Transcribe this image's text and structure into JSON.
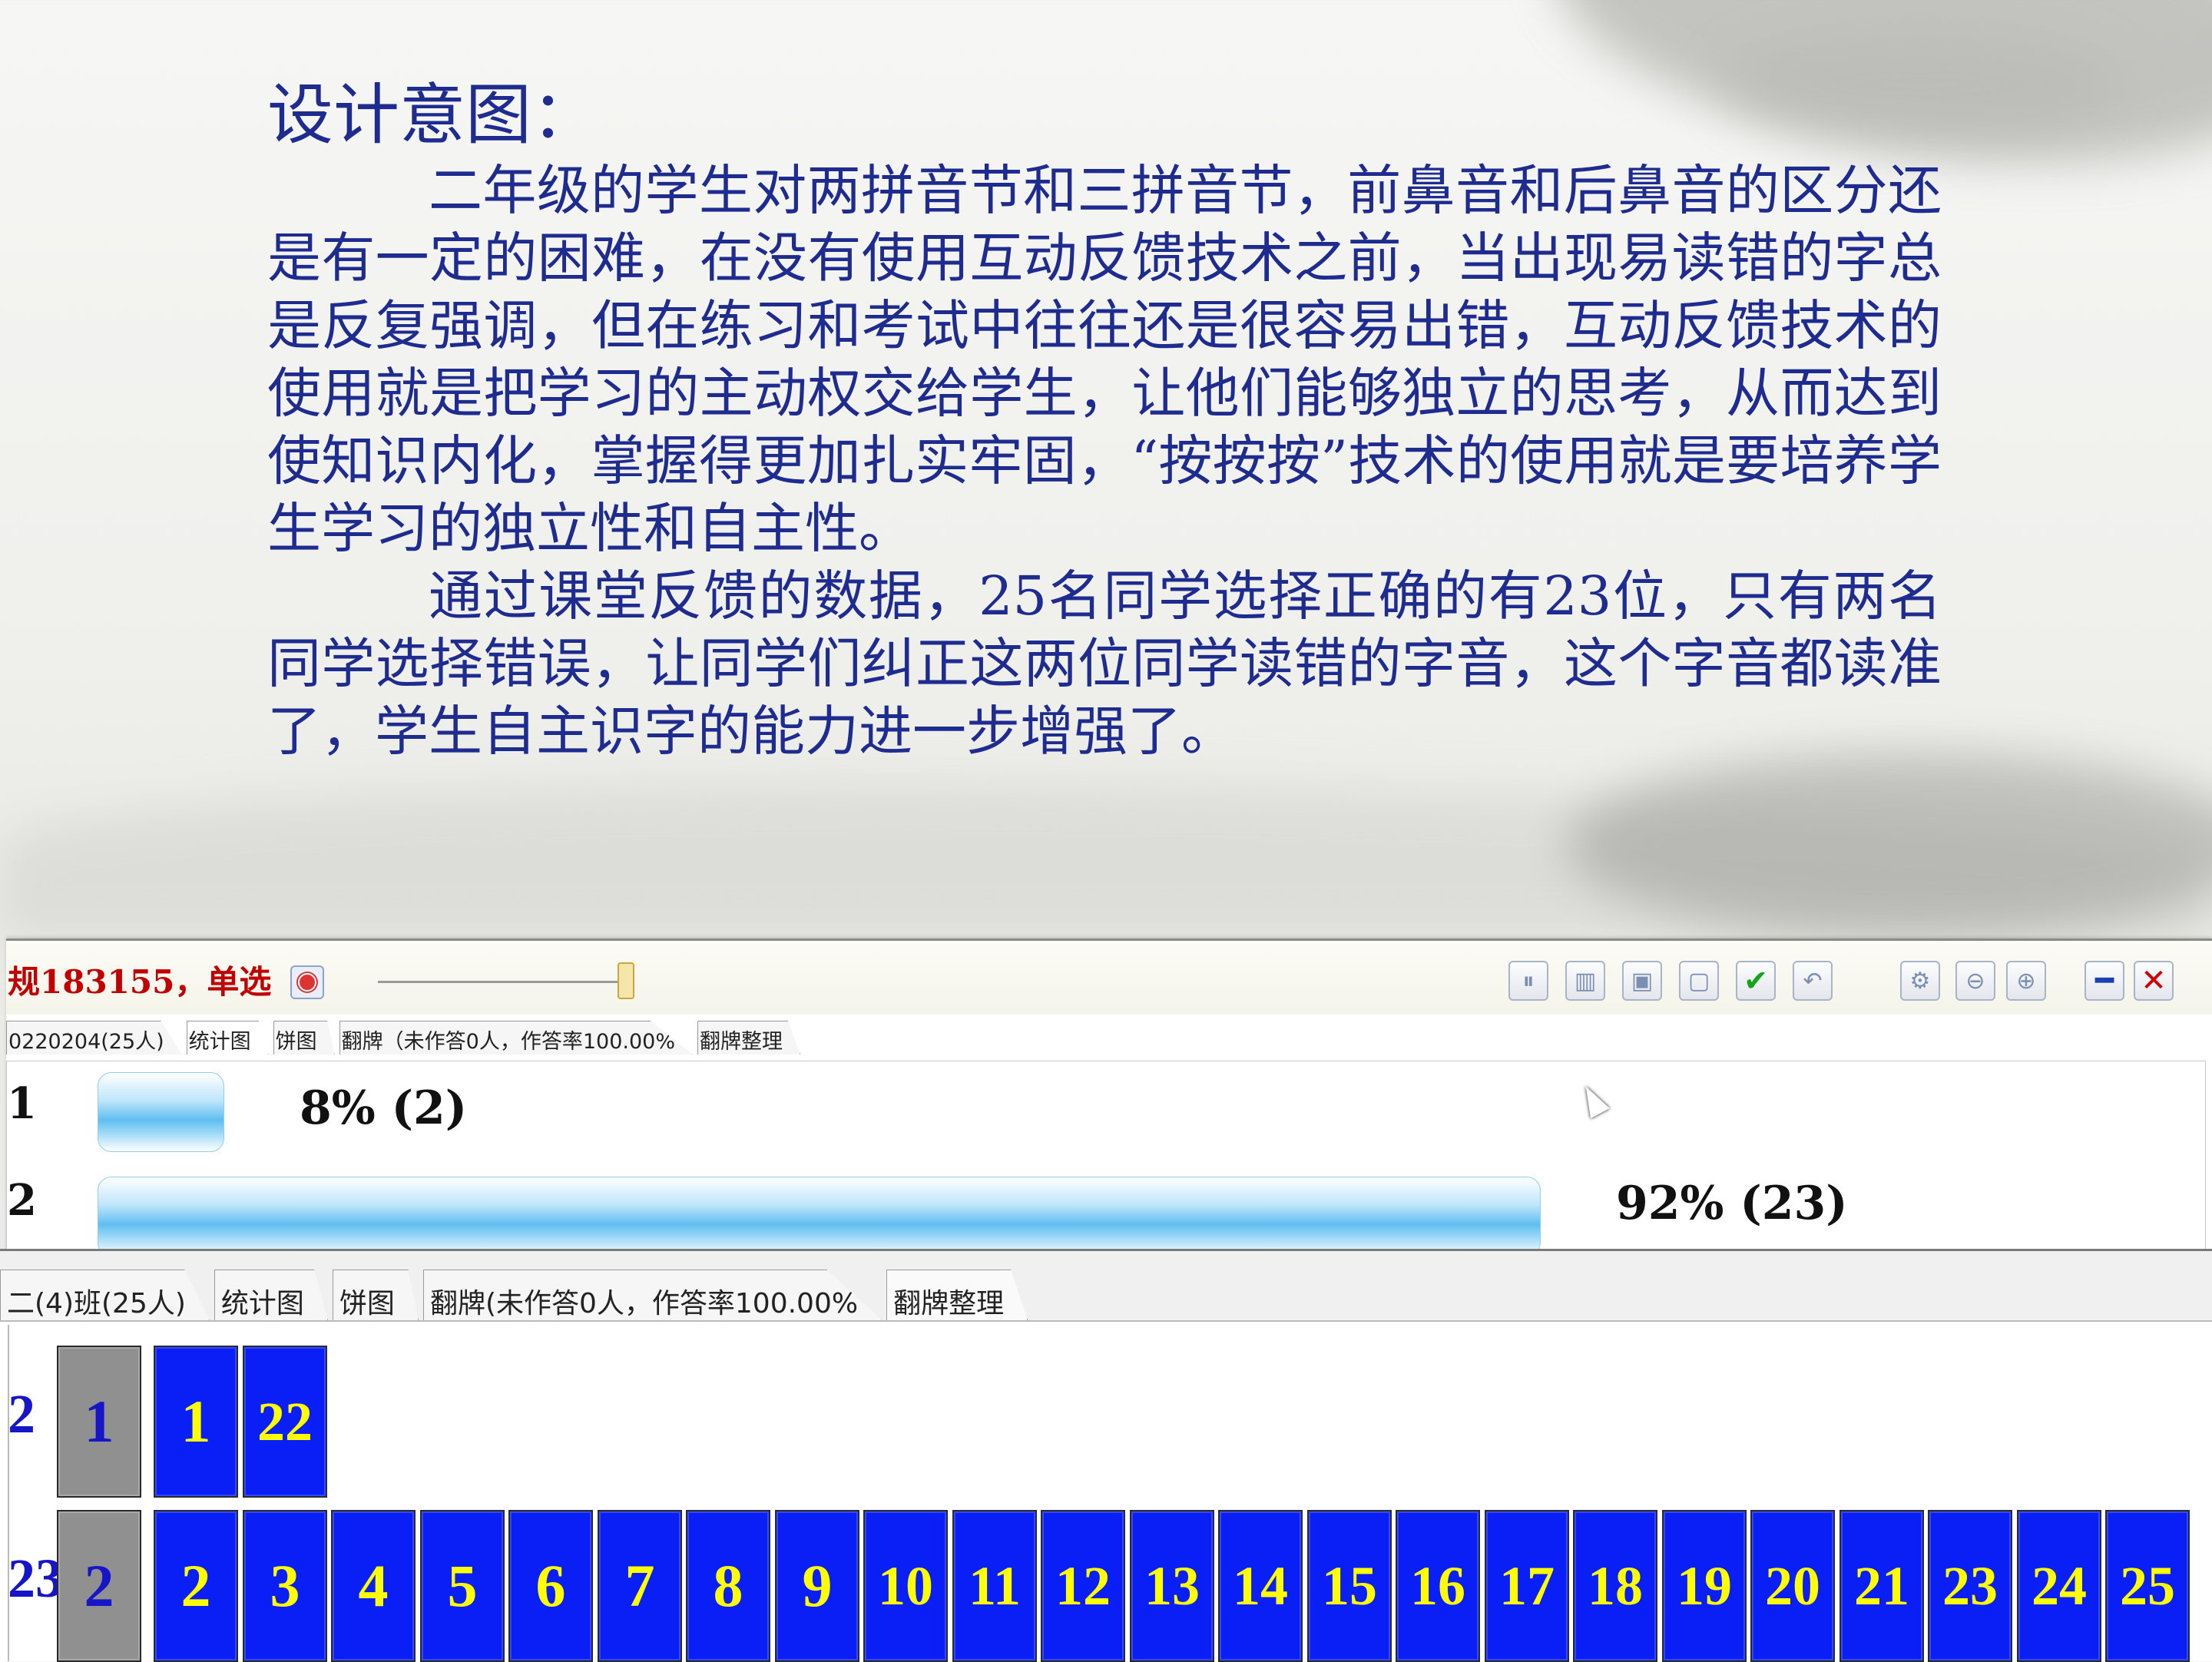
{
  "slide": {
    "heading": "设计意图：",
    "paragraph1": "二年级的学生对两拼音节和三拼音节，前鼻音和后鼻音的区分还是有一定的困难，在没有使用互动反馈技术之前，当出现易读错的字总是反复强调，但在练习和考试中往往还是很容易出错，互动反馈技术的使用就是把学习的主动权交给学生，让他们能够独立的思考，从而达到使知识内化，掌握得更加扎实牢固，“按按按”技术的使用就是要培养学生学习的独立性和自主性。",
    "paragraph2": "通过课堂反馈的数据，25名同学选择正确的有23位，只有两名同学选择错误，让同学们纠正这两位同学读错的字音，这个字音都读准了，学生自主识字的能力进一步增强了。"
  },
  "poll_window": {
    "title": "规183155，单选",
    "tabs": [
      "0220204(25人)",
      "统计图",
      "饼图",
      "翻牌（未作答0人，作答率100.00%",
      "翻牌整理"
    ],
    "active_tab": 1,
    "toolbar_icons": [
      "pause-icon",
      "bar-chart-icon",
      "grid-icon",
      "window-icon",
      "check-icon",
      "undo-icon",
      "settings-icon",
      "zoom-out-icon",
      "zoom-in-icon",
      "minimize-icon",
      "close-icon"
    ],
    "colors": {
      "title": "#c00000",
      "bar": "#5fbef0"
    }
  },
  "chart_data": {
    "type": "bar",
    "orientation": "horizontal",
    "categories": [
      "1",
      "2"
    ],
    "values": [
      2,
      23
    ],
    "percent": [
      8,
      92
    ],
    "labels": [
      "8% (2)",
      "92% (23)"
    ],
    "total": 25
  },
  "card_window": {
    "tabs": [
      "二(4)班(25人)",
      "统计图",
      "饼图",
      "翻牌(未作答0人，作答率100.00%",
      "翻牌整理"
    ],
    "active_tab": 4,
    "rows": [
      {
        "count": "2",
        "option": "1",
        "students": [
          "1",
          "22"
        ]
      },
      {
        "count": "23",
        "option": "2",
        "students": [
          "2",
          "3",
          "4",
          "5",
          "6",
          "7",
          "8",
          "9",
          "10",
          "11",
          "12",
          "13",
          "14",
          "15",
          "16",
          "17",
          "18",
          "19",
          "20",
          "21",
          "23",
          "24",
          "25"
        ]
      }
    ],
    "colors": {
      "card": "#0a1ff5",
      "card_text": "#ffff00",
      "option_card": "#909090",
      "option_text": "#1616c8"
    }
  }
}
